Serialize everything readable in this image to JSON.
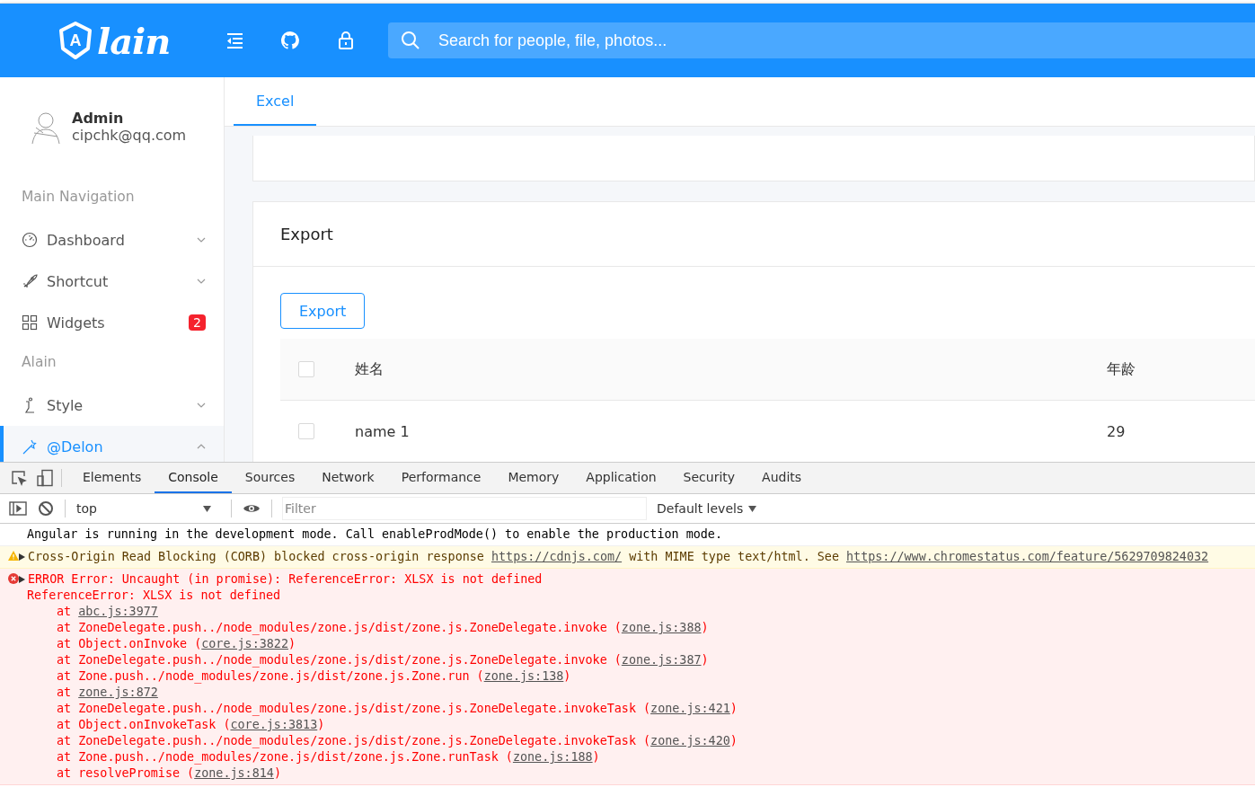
{
  "header": {
    "logo": {
      "mark": "A",
      "text": "lain"
    },
    "search": {
      "placeholder": "Search for people, file, photos..."
    }
  },
  "sidebar": {
    "user": {
      "name": "Admin",
      "email": "cipchk@qq.com"
    },
    "items": [
      {
        "kind": "group",
        "label": "Main Navigation"
      },
      {
        "kind": "item",
        "label": "Dashboard",
        "expanded": false,
        "selected": false
      },
      {
        "kind": "item",
        "label": "Shortcut",
        "expanded": false,
        "selected": false
      },
      {
        "kind": "item",
        "label": "Widgets",
        "badge": "2",
        "selected": false
      },
      {
        "kind": "group",
        "label": "Alain"
      },
      {
        "kind": "item",
        "label": "Style",
        "expanded": false,
        "selected": false
      },
      {
        "kind": "item",
        "label": "@Delon",
        "expanded": true,
        "selected": true
      }
    ]
  },
  "content": {
    "tabs": [
      {
        "label": "Excel",
        "selected": true
      }
    ],
    "card": {
      "title": "Export",
      "button": "Export",
      "table": {
        "columns": [
          "姓名",
          "年龄"
        ],
        "header_checked": false,
        "rows": [
          {
            "checked": false,
            "cells": [
              "name 1",
              "29"
            ]
          }
        ]
      }
    }
  },
  "devtools": {
    "tabs": [
      {
        "label": "Elements",
        "selected": false
      },
      {
        "label": "Console",
        "selected": true
      },
      {
        "label": "Sources",
        "selected": false
      },
      {
        "label": "Network",
        "selected": false
      },
      {
        "label": "Performance",
        "selected": false
      },
      {
        "label": "Memory",
        "selected": false
      },
      {
        "label": "Application",
        "selected": false
      },
      {
        "label": "Security",
        "selected": false
      },
      {
        "label": "Audits",
        "selected": false
      }
    ],
    "context": "top",
    "filter": {
      "placeholder": "Filter"
    },
    "levels": "Default levels",
    "messages": [
      {
        "kind": "info",
        "parts": [
          {
            "text": "Angular is running in the development mode. Call enableProdMode() to enable the production mode."
          }
        ]
      },
      {
        "kind": "warning",
        "parts": [
          {
            "text": "Cross-Origin Read Blocking (CORB) blocked cross-origin response "
          },
          {
            "link": "https://cdnjs.com/"
          },
          {
            "text": " with MIME type text/html. See "
          },
          {
            "link": "https://www.chromestatus.com/feature/5629709824032"
          }
        ]
      },
      {
        "kind": "error",
        "parts": [
          {
            "text": "ERROR Error: Uncaught (in promise): ReferenceError: XLSX is not defined"
          }
        ],
        "detail": "ReferenceError: XLSX is not defined",
        "frames": [
          {
            "lead": "at ",
            "link": "abc.js:3977"
          },
          {
            "lead": "at ZoneDelegate.push../node_modules/zone.js/dist/zone.js.ZoneDelegate.invoke (",
            "link": "zone.js:388",
            "tail": ")"
          },
          {
            "lead": "at Object.onInvoke (",
            "link": "core.js:3822",
            "tail": ")"
          },
          {
            "lead": "at ZoneDelegate.push../node_modules/zone.js/dist/zone.js.ZoneDelegate.invoke (",
            "link": "zone.js:387",
            "tail": ")"
          },
          {
            "lead": "at Zone.push../node_modules/zone.js/dist/zone.js.Zone.run (",
            "link": "zone.js:138",
            "tail": ")"
          },
          {
            "lead": "at ",
            "link": "zone.js:872"
          },
          {
            "lead": "at ZoneDelegate.push../node_modules/zone.js/dist/zone.js.ZoneDelegate.invokeTask (",
            "link": "zone.js:421",
            "tail": ")"
          },
          {
            "lead": "at Object.onInvokeTask (",
            "link": "core.js:3813",
            "tail": ")"
          },
          {
            "lead": "at ZoneDelegate.push../node_modules/zone.js/dist/zone.js.ZoneDelegate.invokeTask (",
            "link": "zone.js:420",
            "tail": ")"
          },
          {
            "lead": "at Zone.push../node_modules/zone.js/dist/zone.js.Zone.runTask (",
            "link": "zone.js:188",
            "tail": ")"
          },
          {
            "lead": "at resolvePromise (",
            "link": "zone.js:814",
            "tail": ")"
          }
        ]
      }
    ]
  }
}
